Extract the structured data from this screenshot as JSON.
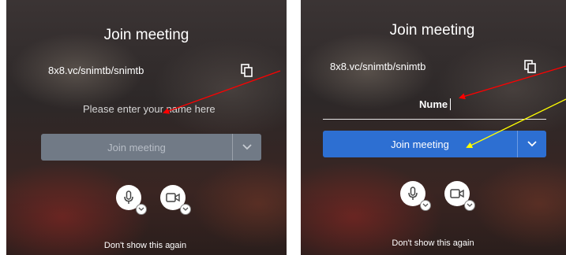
{
  "left_panel": {
    "title": "Join meeting",
    "meeting_url": "8x8.vc/snimtb/snimtb",
    "copy_icon": "copy-icon",
    "name_placeholder": "Please enter your name here",
    "join_button": "Join meeting",
    "join_state": "disabled",
    "microphone_icon": "microphone-icon",
    "camera_icon": "camera-icon",
    "dont_show": "Don't show this again"
  },
  "right_panel": {
    "title": "Join meeting",
    "meeting_url": "8x8.vc/snimtb/snimtb",
    "copy_icon": "copy-icon",
    "name_value": "Nume",
    "join_button": "Join meeting",
    "join_state": "enabled",
    "microphone_icon": "microphone-icon",
    "camera_icon": "camera-icon",
    "dont_show": "Don't show this again"
  },
  "annotations": {
    "arrow_colors": [
      "#ff0000",
      "#ff0000",
      "#ffff00"
    ]
  },
  "colors": {
    "join_active": "#2d6fd2",
    "join_disabled": "#717a86"
  }
}
